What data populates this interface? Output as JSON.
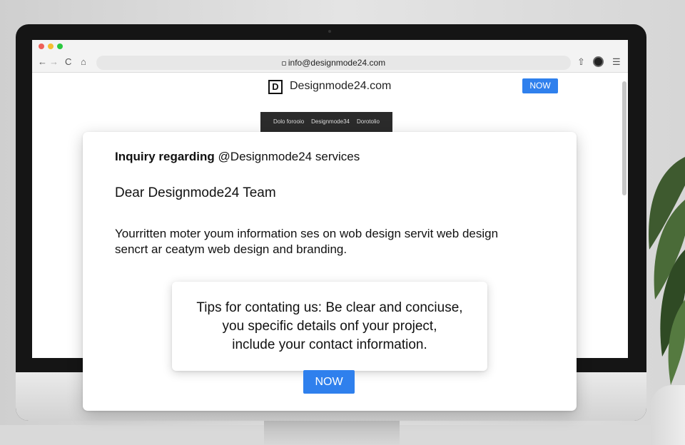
{
  "browser": {
    "address": "info@designmode24.com",
    "nav": {
      "back": "←",
      "forward": "→",
      "reload": "C",
      "home": "⌂"
    },
    "toolbar_icons": [
      "share-icon",
      "avatar",
      "menu-icon"
    ],
    "traffic_colors": [
      "#ee5f57",
      "#f5bd2f",
      "#2ac840"
    ]
  },
  "site": {
    "brand_letter": "D",
    "brand_name": "Designmode24.com",
    "header_button": "NOW",
    "strip_items": [
      "Dolo forooio",
      "Designmode34",
      "Dorotolio"
    ]
  },
  "email": {
    "subject_prefix": "Inquiry regarding",
    "subject_rest": "@Designmode24 services",
    "salutation": "Dear Designmode24 Team",
    "body_line1": "Yourritten moter youm information ses on wob design servit web design",
    "body_line2": "sencrt ar ceatym web design and branding."
  },
  "tips": {
    "line1": "Tips for contating us: Be clear and conciuse,",
    "line2": "you specific details onf your project,",
    "line3": "include your contact information."
  },
  "cta": {
    "label": "NOW"
  },
  "colors": {
    "accent": "#2f80ed",
    "bezel": "#151515"
  }
}
